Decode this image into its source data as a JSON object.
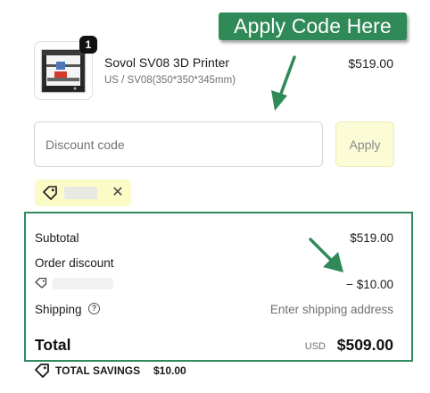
{
  "callout": {
    "text": "Apply Code Here",
    "color": "#2f8a58"
  },
  "product": {
    "quantity": "1",
    "name": "Sovol SV08 3D Printer",
    "variant": "US / SV08(350*350*345mm)",
    "price": "$519.00",
    "image_icon": "3d-printer-image"
  },
  "discount": {
    "placeholder": "Discount code",
    "value": "",
    "apply_label": "Apply",
    "applied_code": "",
    "remove_icon": "close-icon",
    "tag_icon": "tag-icon"
  },
  "summary": {
    "subtotal_label": "Subtotal",
    "subtotal_value": "$519.00",
    "order_discount_label": "Order discount",
    "order_discount_value": "− $10.00",
    "shipping_label": "Shipping",
    "shipping_value": "Enter shipping address",
    "help_icon": "question-circle-icon",
    "total_label": "Total",
    "currency": "USD",
    "total_value": "$509.00",
    "border_color": "#2f8a5e"
  },
  "savings": {
    "label": "TOTAL SAVINGS",
    "value": "$10.00"
  }
}
